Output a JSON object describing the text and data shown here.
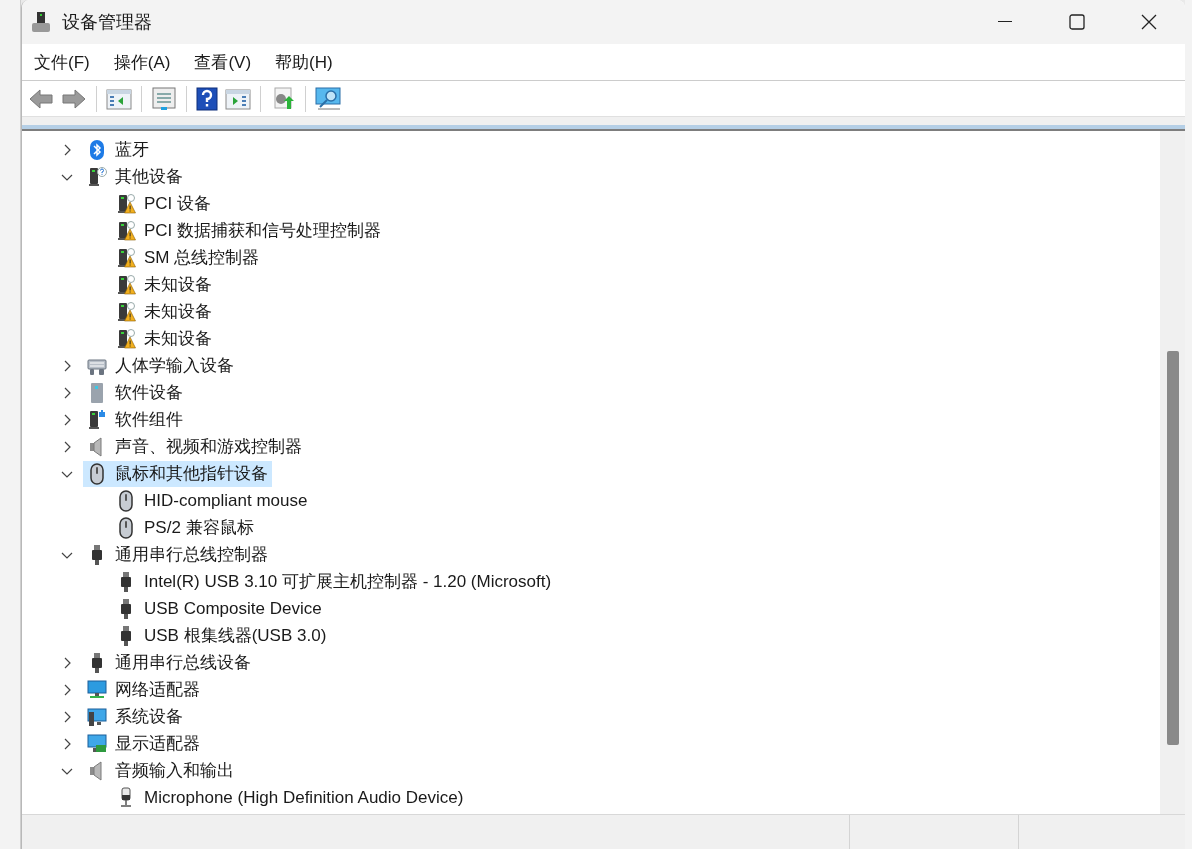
{
  "window": {
    "title": "设备管理器"
  },
  "menu": [
    "文件(F)",
    "操作(A)",
    "查看(V)",
    "帮助(H)"
  ],
  "tree": [
    {
      "label": "蓝牙",
      "kind": "bluetooth",
      "expanded": false,
      "selected": false
    },
    {
      "label": "其他设备",
      "kind": "other",
      "expanded": true,
      "selected": false,
      "children": [
        {
          "label": "PCI 设备",
          "kind": "warning",
          "selected": false
        },
        {
          "label": "PCI 数据捕获和信号处理控制器",
          "kind": "warning",
          "selected": false
        },
        {
          "label": "SM 总线控制器",
          "kind": "warning",
          "selected": false
        },
        {
          "label": "未知设备",
          "kind": "warning",
          "selected": false
        },
        {
          "label": "未知设备",
          "kind": "warning",
          "selected": false
        },
        {
          "label": "未知设备",
          "kind": "warning",
          "selected": false
        }
      ]
    },
    {
      "label": "人体学输入设备",
      "kind": "hid",
      "expanded": false,
      "selected": false
    },
    {
      "label": "软件设备",
      "kind": "softdev",
      "expanded": false,
      "selected": false
    },
    {
      "label": "软件组件",
      "kind": "softcomp",
      "expanded": false,
      "selected": false
    },
    {
      "label": "声音、视频和游戏控制器",
      "kind": "audio",
      "expanded": false,
      "selected": false
    },
    {
      "label": "鼠标和其他指针设备",
      "kind": "mouse",
      "expanded": true,
      "selected": true,
      "children": [
        {
          "label": "HID-compliant mouse",
          "kind": "mouse",
          "selected": false
        },
        {
          "label": "PS/2 兼容鼠标",
          "kind": "mouse",
          "selected": false
        }
      ]
    },
    {
      "label": "通用串行总线控制器",
      "kind": "usb",
      "expanded": true,
      "selected": false,
      "children": [
        {
          "label": "Intel(R) USB 3.10 可扩展主机控制器 - 1.20 (Microsoft)",
          "kind": "usb",
          "selected": false
        },
        {
          "label": "USB Composite Device",
          "kind": "usb",
          "selected": false
        },
        {
          "label": "USB 根集线器(USB 3.0)",
          "kind": "usb",
          "selected": false
        }
      ]
    },
    {
      "label": "通用串行总线设备",
      "kind": "usb",
      "expanded": false,
      "selected": false
    },
    {
      "label": "网络适配器",
      "kind": "network",
      "expanded": false,
      "selected": false
    },
    {
      "label": "系统设备",
      "kind": "system",
      "expanded": false,
      "selected": false
    },
    {
      "label": "显示适配器",
      "kind": "display",
      "expanded": false,
      "selected": false
    },
    {
      "label": "音频输入和输出",
      "kind": "audio",
      "expanded": true,
      "selected": false,
      "children": [
        {
          "label": "Microphone (High Definition Audio Device)",
          "kind": "microphone",
          "selected": false
        }
      ]
    }
  ]
}
